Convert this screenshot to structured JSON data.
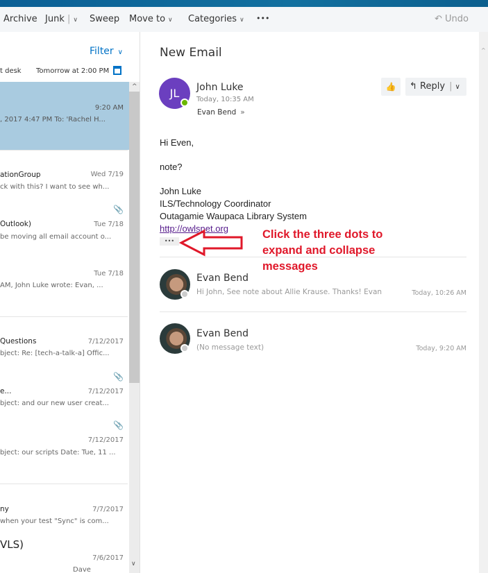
{
  "toolbar": {
    "archive": "Archive",
    "junk": "Junk",
    "sweep": "Sweep",
    "move_to": "Move to",
    "categories": "Categories",
    "more": "•••",
    "undo": "Undo"
  },
  "list": {
    "filter": "Filter",
    "reminder_left": "t desk",
    "reminder_time": "Tomorrow at 2:00 PM",
    "items": [
      {
        "sender": "",
        "date": "9:20 AM",
        "preview": ", 2017 4:47 PM To: 'Rachel H..."
      },
      {
        "sender": "ationGroup",
        "date": "Wed 7/19",
        "preview": "ck with this? I want to see wh..."
      },
      {
        "sender": "Outlook)",
        "date": "Tue 7/18",
        "preview": "be moving all email account o..."
      },
      {
        "sender": "",
        "date": "Tue 7/18",
        "preview": "AM, John Luke wrote: Evan, ..."
      },
      {
        "sender": "Questions",
        "date": "7/12/2017",
        "preview": "bject: Re: [tech-a-talk-a] Offic..."
      },
      {
        "sender": "e...",
        "date": "7/12/2017",
        "preview": "bject: and our new user creat..."
      },
      {
        "sender": "",
        "date": "7/12/2017",
        "preview": "bject: our scripts Date: Tue, 11 ..."
      },
      {
        "sender": "ny",
        "date": "7/7/2017",
        "preview": "when your test \"Sync\" is com..."
      },
      {
        "sender": "VLS)",
        "date": "7/6/2017",
        "preview": "Dave"
      }
    ]
  },
  "reading": {
    "subject": "New Email",
    "message": {
      "initials": "JL",
      "sender": "John Luke",
      "time": "Today, 10:35 AM",
      "to": "Evan Bend",
      "reply": "Reply",
      "body": [
        "Hi Even,",
        "note?",
        "John Luke",
        "ILS/Technology Coordinator",
        "Outagamie Waupaca Library System"
      ],
      "link": "http://owlsnet.org",
      "expand": "•••"
    },
    "annotation": [
      "Click the three dots to",
      "expand and collapse",
      "messages"
    ],
    "collapsed": [
      {
        "sender": "Evan Bend",
        "preview": "Hi John, See note about Allie Krause. Thanks! Evan",
        "time": "Today, 10:26 AM"
      },
      {
        "sender": "Evan Bend",
        "preview": "(No message text)",
        "time": "Today, 9:20 AM"
      }
    ]
  },
  "colors": {
    "selected": "#a9cbe0",
    "accent": "#0072c6",
    "avatar": "#6b3fbf",
    "annotation": "#e0182a"
  }
}
